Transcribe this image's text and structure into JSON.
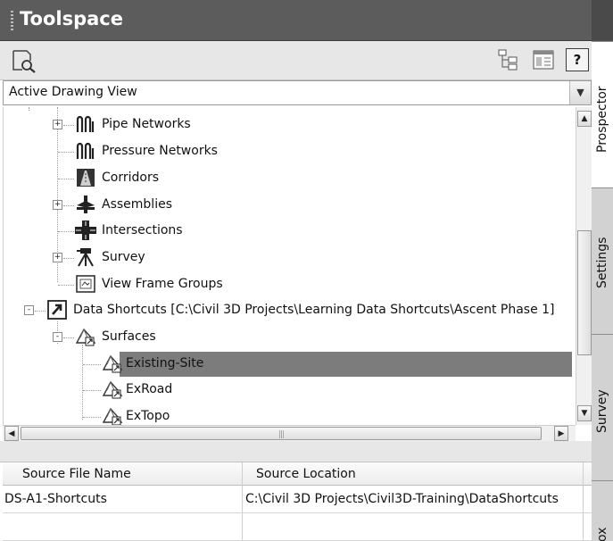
{
  "titlebar": {
    "title": "Toolspace"
  },
  "toolbar": {
    "help_label": "?"
  },
  "view_select": {
    "value": "Active Drawing View"
  },
  "tree": {
    "items": [
      {
        "label": "Pipe Networks",
        "icon": "pipe-network-icon",
        "expander": "+"
      },
      {
        "label": "Pressure Networks",
        "icon": "pressure-network-icon"
      },
      {
        "label": "Corridors",
        "icon": "corridor-icon"
      },
      {
        "label": "Assemblies",
        "icon": "assembly-icon",
        "expander": "+"
      },
      {
        "label": "Intersections",
        "icon": "intersection-icon"
      },
      {
        "label": "Survey",
        "icon": "survey-icon",
        "expander": "+"
      },
      {
        "label": "View Frame Groups",
        "icon": "view-frame-icon"
      },
      {
        "label": "Data Shortcuts [C:\\Civil 3D Projects\\Learning Data Shortcuts\\Ascent Phase 1]",
        "icon": "data-shortcut-icon",
        "expander": "-"
      },
      {
        "label": "Surfaces",
        "icon": "surface-folder-icon",
        "expander": "-"
      },
      {
        "label": "Existing-Site",
        "icon": "surface-shortcut-icon",
        "selected": true
      },
      {
        "label": "ExRoad",
        "icon": "surface-shortcut-icon"
      },
      {
        "label": "ExTopo",
        "icon": "surface-shortcut-icon"
      }
    ]
  },
  "grid": {
    "columns": [
      "Source File Name",
      "Source Location"
    ],
    "rows": [
      [
        "DS-A1-Shortcuts",
        "C:\\Civil 3D Projects\\Civil3D-Training\\DataShortcuts"
      ]
    ]
  },
  "side_tabs": [
    "Prospector",
    "Settings",
    "Survey",
    "ox"
  ],
  "colors": {
    "title_bg": "#5c5c5c",
    "selected_row": "#7c7c7c",
    "panel_bg": "#e7e7e7"
  }
}
